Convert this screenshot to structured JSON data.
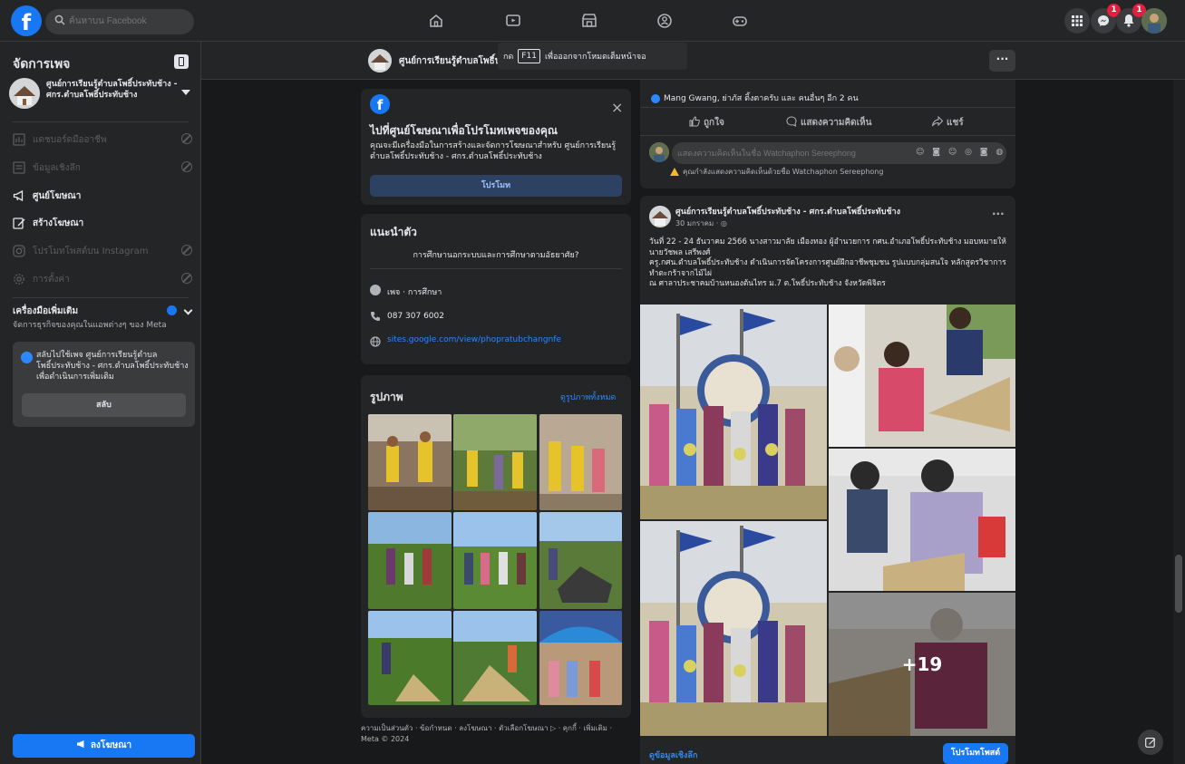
{
  "topbar": {
    "logo": "f",
    "search_placeholder": "ค้นหาบน Facebook",
    "notifications_badge": "1",
    "messenger_badge": "1"
  },
  "sidebar": {
    "title": "จัดการเพจ",
    "page_name": "ศูนย์การเรียนรู้ตำบลโพธิ์ประทับช้าง - ศกร.ตำบลโพธิ์ประทับช้าง",
    "items": [
      {
        "label": "แดชบอร์ดมืออาชีพ",
        "disabled": true
      },
      {
        "label": "ข้อมูลเชิงลึก",
        "disabled": true
      },
      {
        "label": "ศูนย์โฆษณา",
        "disabled": false
      },
      {
        "label": "สร้างโฆษณา",
        "disabled": false
      },
      {
        "label": "โปรโมทโพสต์บน Instagram",
        "disabled": true
      },
      {
        "label": "การตั้งค่า",
        "disabled": true
      }
    ],
    "tools_title": "เครื่องมือเพิ่มเติม",
    "tools_desc": "จัดการธุรกิจของคุณในแอพต่างๆ ของ Meta",
    "switch_text": "สลับไปใช้เพจ ศูนย์การเรียนรู้ตำบลโพธิ์ประทับช้าง - ศกร.ตำบลโพธิ์ประทับช้าง เพื่อดำเนินการเพิ่มเติม",
    "switch_button": "สลับ",
    "promote_button": "ลงโฆษณา"
  },
  "header": {
    "page_name": "ศูนย์การเรียนรู้ตำบลโพธิ์ประทับช้าง",
    "f11_before": "กด",
    "f11_key": "F11",
    "f11_after": "เพื่อออกจากโหมดเต็มหน้าจอ",
    "more": "···"
  },
  "ad_card": {
    "title": "ไปที่ศูนย์โฆษณาเพื่อโปรโมทเพจของคุณ",
    "desc": "คุณจะมีเครื่องมือในการสร้างและจัดการโฆษณาสำหรับ ศูนย์การเรียนรู้ตำบลโพธิ์ประทับช้าง - ศกร.ตำบลโพธิ์ประทับช้าง",
    "button": "โปรโมท",
    "close": "×"
  },
  "intro": {
    "title": "แนะนำตัว",
    "bio": "การศึกษานอกระบบและการศึกษาตามอัธยาศัย?",
    "category": "เพจ · การศึกษา",
    "phone": "087 307 6002",
    "website": "sites.google.com/view/phopratubchangnfe"
  },
  "photos": {
    "title": "รูปภาพ",
    "see_all": "ดูรูปภาพทั้งหมด"
  },
  "footer": "ความเป็นส่วนตัว · ข้อกำหนด · ลงโฆษณา · ตัวเลือกโฆษณา ▷ · คุกกี้ · เพิ่มเติม · Meta © 2024",
  "post1": {
    "reactions": "Mang Gwang, ย่าภัส ติ้งตาครับ และ คนอื่นๆ อีก 2 คน",
    "like": "ถูกใจ",
    "comment": "แสดงความคิดเห็น",
    "share": "แชร์",
    "comment_placeholder": "แสดงความคิดเห็นในชื่อ Watchaphon Sereephong",
    "comment_icons": "☺ ◙ ☺ ◎ ◙ ◍",
    "warning": "คุณกำลังแสดงความคิดเห็นด้วยชื่อ Watchaphon Sereephong"
  },
  "post2": {
    "author": "ศูนย์การเรียนรู้ตำบลโพธิ์ประทับช้าง - ศกร.ตำบลโพธิ์ประทับช้าง",
    "time": "30 มกราคม · ◎",
    "more": "···",
    "text": "วันที่ 22 - 24 ธันวาคม 2566 นางสาวมาลัย เมืองทอง ผู้อำนวยการ กศน.อำเภอโพธิ์ประทับช้าง มอบหมายให้ นายวัชพล เสรีพงศ์\nครู.กศน.ตำบลโพธิ์ประทับช้าง ดำเนินการจัดโครงการศูนย์ฝึกอาชีพชุมชน รูปแบบกลุ่มสนใจ หลักสูตรวิชาการทำตะกร้าจากไม้ไผ่\nณ ศาลาประชาคมบ้านหนองต้นไทร ม.7 ต.โพธิ์ประทับช้าง จังหวัดพิจิตร",
    "more_photos": "+19",
    "details": "ดูข้อมูลเชิงลึก",
    "boost": "โปรโมทโพสต์"
  },
  "colors": {
    "bg": "#18191a",
    "card": "#242526",
    "accent": "#1877f2",
    "badge": "#e41e3f"
  }
}
